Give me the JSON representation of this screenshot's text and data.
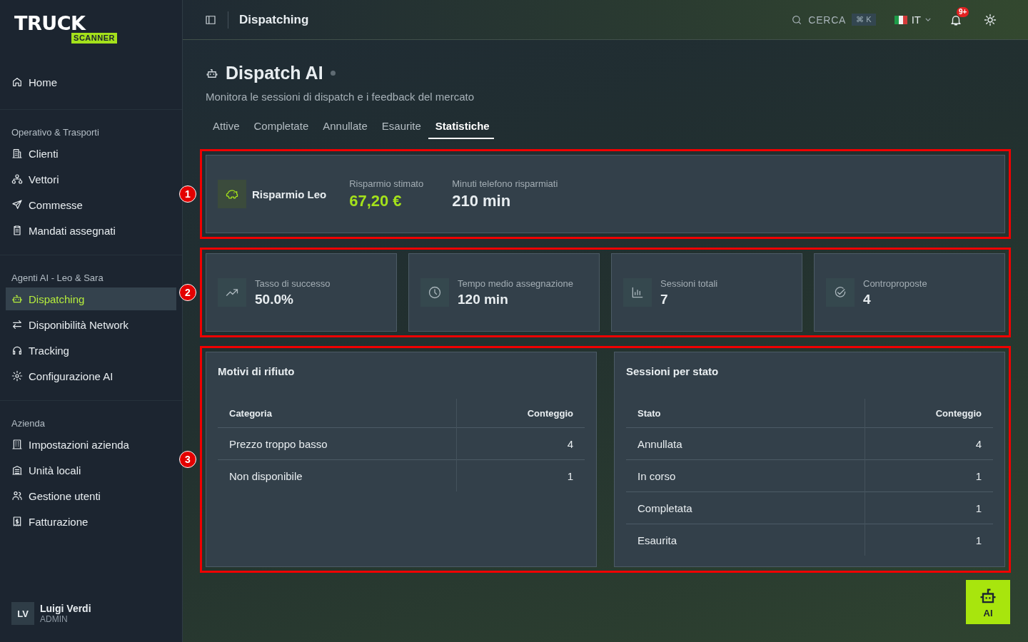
{
  "logo": {
    "word": "TRUCK",
    "badge": "SCANNER"
  },
  "sidebar": {
    "home": {
      "label": "Home",
      "selected": false
    },
    "sections": [
      {
        "title": "Operativo & Trasporti",
        "items": [
          {
            "label": "Clienti",
            "selected": false
          },
          {
            "label": "Vettori",
            "selected": false
          },
          {
            "label": "Commesse",
            "selected": false
          },
          {
            "label": "Mandati assegnati",
            "selected": false
          }
        ]
      },
      {
        "title": "Agenti AI - Leo & Sara",
        "items": [
          {
            "label": "Dispatching",
            "selected": true
          },
          {
            "label": "Disponibilità Network",
            "selected": false
          },
          {
            "label": "Tracking",
            "selected": false
          },
          {
            "label": "Configurazione AI",
            "selected": false
          }
        ]
      },
      {
        "title": "Azienda",
        "items": [
          {
            "label": "Impostazioni azienda",
            "selected": false
          },
          {
            "label": "Unità locali",
            "selected": false
          },
          {
            "label": "Gestione utenti",
            "selected": false
          },
          {
            "label": "Fatturazione",
            "selected": false
          }
        ]
      }
    ]
  },
  "user": {
    "initials": "LV",
    "name": "Luigi Verdi",
    "role": "ADMIN"
  },
  "topbar": {
    "title": "Dispatching",
    "search": "CERCA",
    "shortcut": "⌘ K",
    "language": "IT",
    "notifications": "9+"
  },
  "page": {
    "title": "Dispatch AI",
    "subtitle": "Monitora le sessioni di dispatch e i feedback del mercato",
    "tabs": [
      {
        "label": "Attive",
        "selected": false
      },
      {
        "label": "Completate",
        "selected": false
      },
      {
        "label": "Annullate",
        "selected": false
      },
      {
        "label": "Esaurite",
        "selected": false
      },
      {
        "label": "Statistiche",
        "selected": true
      }
    ]
  },
  "savings": {
    "marker": "1",
    "title": "Risparmio Leo",
    "metrics": [
      {
        "label": "Risparmio stimato",
        "value": "67,20 €",
        "kind": "money"
      },
      {
        "label": "Minuti telefono risparmiati",
        "value": "210 min",
        "kind": "plain"
      }
    ]
  },
  "stats": {
    "marker": "2",
    "cards": [
      {
        "label": "Tasso di successo",
        "value": "50.0%"
      },
      {
        "label": "Tempo medio assegnazione",
        "value": "120 min"
      },
      {
        "label": "Sessioni totali",
        "value": "7"
      },
      {
        "label": "Controproposte",
        "value": "4"
      }
    ]
  },
  "tables": {
    "marker": "3",
    "panels": [
      {
        "title": "Motivi di rifiuto",
        "columns": [
          "Categoria",
          "Conteggio"
        ],
        "rows": [
          [
            "Prezzo troppo basso",
            "4"
          ],
          [
            "Non disponibile",
            "1"
          ]
        ]
      },
      {
        "title": "Sessioni per stato",
        "columns": [
          "Stato",
          "Conteggio"
        ],
        "rows": [
          [
            "Annullata",
            "4"
          ],
          [
            "In corso",
            "1"
          ],
          [
            "Completata",
            "1"
          ],
          [
            "Esaurita",
            "1"
          ]
        ]
      }
    ]
  },
  "assistant_button": {
    "label": "AI"
  }
}
